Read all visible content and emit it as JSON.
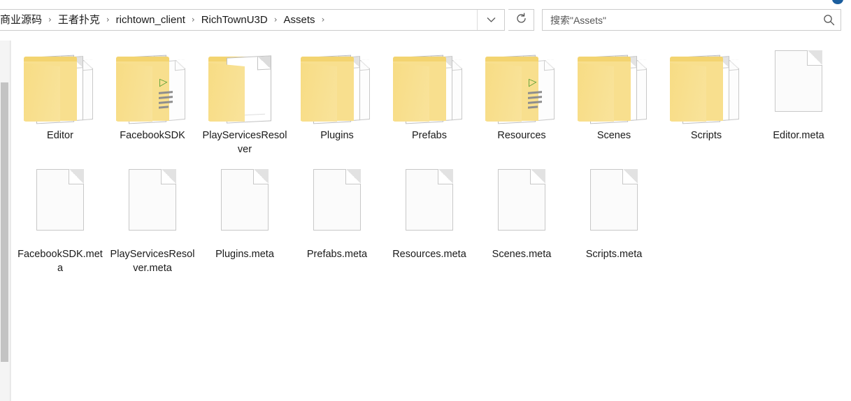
{
  "window": {
    "title": "Assets"
  },
  "addressbar": {
    "crumbs": [
      {
        "label": "商业源码"
      },
      {
        "label": "王者扑克"
      },
      {
        "label": "richtown_client"
      },
      {
        "label": "RichTownU3D"
      },
      {
        "label": "Assets"
      }
    ],
    "separator": "›",
    "dropdown_icon": "chevron-down-icon",
    "refresh_icon": "refresh-icon",
    "refresh_glyph": "↻"
  },
  "search": {
    "placeholder": "搜索\"Assets\"",
    "value": "",
    "icon": "search-icon"
  },
  "colors": {
    "folder_yellow": "#f8df8e",
    "folder_lip": "#f3d470",
    "doc_white": "#fbfbfb",
    "doc_border": "#c8c8c8",
    "code_green": "#4f9b2f",
    "scrollbar_thumb": "#c3c3c3",
    "accent_blue": "#1b5e9e",
    "text": "#1a1a1a"
  },
  "files": {
    "row1": [
      {
        "name": "Editor",
        "type": "folder",
        "variant": "sheets"
      },
      {
        "name": "FacebookSDK",
        "type": "folder",
        "variant": "code"
      },
      {
        "name": "PlayServicesResolver",
        "type": "folder",
        "variant": "page"
      },
      {
        "name": "Plugins",
        "type": "folder",
        "variant": "sheets"
      },
      {
        "name": "Prefabs",
        "type": "folder",
        "variant": "sheets"
      },
      {
        "name": "Resources",
        "type": "folder",
        "variant": "code"
      },
      {
        "name": "Scenes",
        "type": "folder",
        "variant": "sheets"
      },
      {
        "name": "Scripts",
        "type": "folder",
        "variant": "sheets"
      },
      {
        "name": "Editor.meta",
        "type": "file",
        "variant": "doc"
      }
    ],
    "row2": [
      {
        "name": "FacebookSDK.meta",
        "type": "file",
        "variant": "doc"
      },
      {
        "name": "PlayServicesResolver.meta",
        "type": "file",
        "variant": "doc"
      },
      {
        "name": "Plugins.meta",
        "type": "file",
        "variant": "doc"
      },
      {
        "name": "Prefabs.meta",
        "type": "file",
        "variant": "doc"
      },
      {
        "name": "Resources.meta",
        "type": "file",
        "variant": "doc"
      },
      {
        "name": "Scenes.meta",
        "type": "file",
        "variant": "doc"
      },
      {
        "name": "Scripts.meta",
        "type": "file",
        "variant": "doc"
      }
    ]
  },
  "scrollbar": {
    "orientation": "vertical",
    "position": "left"
  }
}
